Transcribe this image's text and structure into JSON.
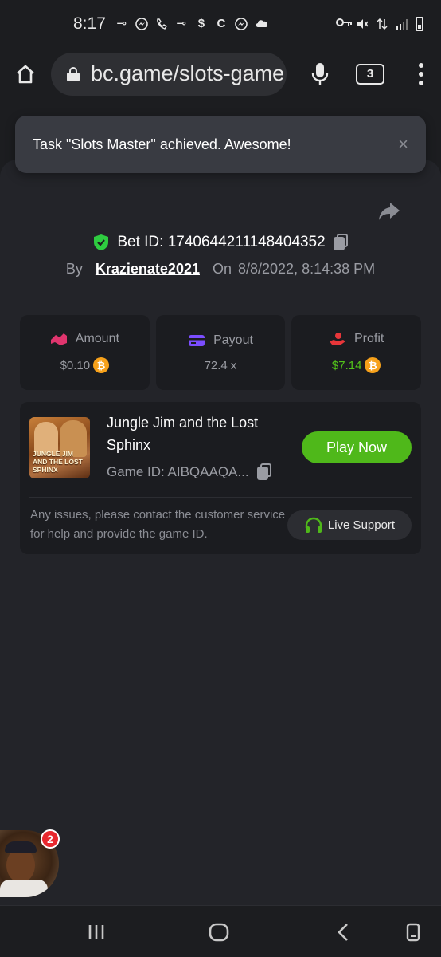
{
  "status_bar": {
    "time": "8:17",
    "icons_left": [
      "key-icon",
      "messenger-icon",
      "missed-call-icon",
      "key-icon",
      "dollar-icon",
      "c-icon",
      "messenger-icon",
      "cloud-icon"
    ],
    "icons_right": [
      "vpn-key-icon",
      "mute-icon",
      "data-icon",
      "signal-icon",
      "battery-icon"
    ]
  },
  "browser": {
    "url": "bc.game/slots-game",
    "tab_count": "3"
  },
  "toast": {
    "message": "Task \"Slots Master\" achieved. Awesome!",
    "close_label": "×"
  },
  "bet": {
    "id_label": "Bet ID: 1740644211148404352",
    "by_label": "By",
    "user": "Krazienate2021",
    "on_label": "On",
    "datetime": "8/8/2022, 8:14:38 PM"
  },
  "stats": [
    {
      "label": "Amount",
      "value": "$0.10",
      "color": "#e0356e"
    },
    {
      "label": "Payout",
      "value": "72.4 x",
      "color": "#7b4dff"
    },
    {
      "label": "Profit",
      "value": "$7.14",
      "color": "#e8363a"
    }
  ],
  "coin_symbol": "₿",
  "game": {
    "title": "Jungle Jim and the Lost Sphinx",
    "thumb_title": "JUNGLE JIM AND THE LOST SPHINX",
    "game_id": "Game ID: AIBQAAQA...",
    "play_label": "Play Now",
    "issues_text": "Any issues, please contact the customer service for help and provide the game ID.",
    "support_label": "Live Support"
  },
  "chat": {
    "badge_count": "2"
  },
  "colors": {
    "accent_green": "#4fb81a",
    "profit_green": "#52c41a",
    "shield_green": "#2ecc40",
    "coin_orange": "#f7a11a",
    "background": "#232429"
  }
}
